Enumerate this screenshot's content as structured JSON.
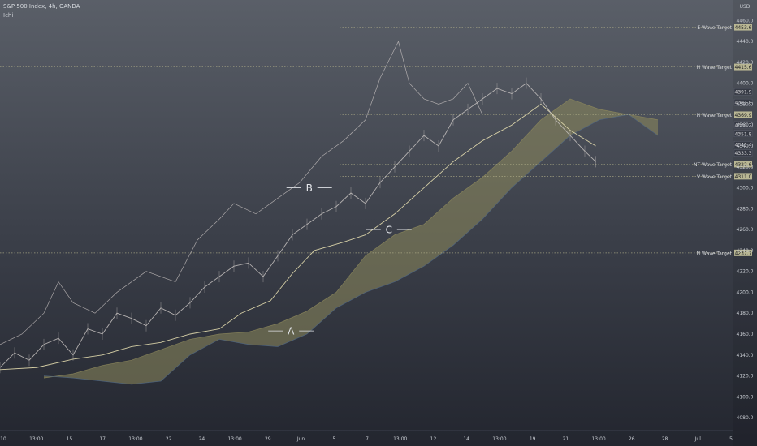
{
  "header": {
    "title": "S&P 500 Index, 4h, OANDA",
    "indicator": "Ichi"
  },
  "colors": {
    "price_line": "#c9c4c2",
    "kijun": "#e7dfb0",
    "tenkan": "#d9d2ce",
    "bull_cloud": "#8e8a5c",
    "bear_cloud": "#4d6787",
    "target_line": "#b6b48c",
    "axis_text": "#c8ccd2"
  },
  "chart_data": {
    "type": "line",
    "y_unit": "USD",
    "ylim": [
      4070,
      4475
    ],
    "y_ticks": [
      4080,
      4100,
      4120,
      4140,
      4160,
      4180,
      4200,
      4220,
      4240,
      4260,
      4280,
      4300,
      4320,
      4340,
      4360,
      4380,
      4400,
      4420,
      4440,
      4460
    ],
    "x_ticks": [
      "10",
      "13:00",
      "15",
      "17",
      "13:00",
      "22",
      "24",
      "13:00",
      "29",
      "Jun",
      "5",
      "7",
      "13:00",
      "12",
      "14",
      "13:00",
      "19",
      "21",
      "13:00",
      "26",
      "28",
      "Jul",
      "5"
    ],
    "grid": false,
    "wave_targets": [
      {
        "name": "E Wave Target",
        "value": 4453.6,
        "label": "4453.6"
      },
      {
        "name": "N Wave Target",
        "value": 4415.6,
        "label": "4415.6"
      },
      {
        "name": "N Wave Target",
        "value": 4369.9,
        "label": "4369.9"
      },
      {
        "name": "NT Wave Target",
        "value": 4322.6,
        "label": "4322.6"
      },
      {
        "name": "V Wave Target",
        "value": 4311.0,
        "label": "4311.0"
      },
      {
        "name": "N Wave Target",
        "value": 4237.7,
        "label": "4237.7"
      }
    ],
    "price_tags": [
      "4391.9",
      "4381.8",
      "4360.2",
      "4351.8",
      "4341.4",
      "4333.3"
    ],
    "wave_points": [
      {
        "label": "A",
        "x": 0.398,
        "y": 4163
      },
      {
        "label": "B",
        "x": 0.423,
        "y": 4300
      },
      {
        "label": "C",
        "x": 0.532,
        "y": 4260
      }
    ],
    "series": [
      {
        "name": "",
        "role": "price",
        "x": [
          0.0,
          0.02,
          0.04,
          0.06,
          0.08,
          0.1,
          0.12,
          0.14,
          0.16,
          0.18,
          0.2,
          0.22,
          0.24,
          0.26,
          0.28,
          0.3,
          0.32,
          0.34,
          0.36,
          0.38,
          0.4,
          0.42,
          0.44,
          0.46,
          0.48,
          0.5,
          0.52,
          0.54,
          0.56,
          0.58,
          0.6,
          0.62,
          0.64,
          0.66,
          0.68,
          0.7,
          0.72,
          0.74,
          0.76,
          0.78,
          0.8,
          0.815
        ],
        "y": [
          4128,
          4142,
          4135,
          4150,
          4156,
          4140,
          4165,
          4160,
          4180,
          4175,
          4168,
          4185,
          4178,
          4190,
          4205,
          4215,
          4225,
          4228,
          4215,
          4235,
          4255,
          4265,
          4275,
          4282,
          4295,
          4285,
          4305,
          4320,
          4335,
          4350,
          4340,
          4365,
          4375,
          4385,
          4395,
          4390,
          4400,
          4385,
          4365,
          4350,
          4335,
          4325
        ]
      },
      {
        "name": "",
        "role": "kijun",
        "x": [
          0.0,
          0.05,
          0.1,
          0.14,
          0.18,
          0.22,
          0.26,
          0.3,
          0.33,
          0.37,
          0.4,
          0.43,
          0.47,
          0.5,
          0.54,
          0.58,
          0.62,
          0.66,
          0.7,
          0.74,
          0.78,
          0.815
        ],
        "y": [
          4126,
          4128,
          4136,
          4140,
          4148,
          4152,
          4160,
          4165,
          4180,
          4192,
          4218,
          4240,
          4248,
          4255,
          4275,
          4300,
          4325,
          4345,
          4360,
          4380,
          4355,
          4340
        ]
      },
      {
        "name": "",
        "role": "lagging",
        "x": [
          0.0,
          0.03,
          0.06,
          0.08,
          0.1,
          0.13,
          0.16,
          0.2,
          0.24,
          0.27,
          0.3,
          0.32,
          0.35,
          0.38,
          0.41,
          0.44,
          0.47,
          0.5,
          0.52,
          0.545,
          0.56,
          0.58,
          0.6,
          0.62,
          0.64,
          0.66
        ],
        "y": [
          4150,
          4160,
          4180,
          4210,
          4190,
          4180,
          4200,
          4220,
          4210,
          4250,
          4270,
          4285,
          4275,
          4290,
          4305,
          4330,
          4345,
          4365,
          4405,
          4440,
          4400,
          4385,
          4380,
          4385,
          4400,
          4370
        ]
      },
      {
        "name": "",
        "role": "senkou_a",
        "x": [
          0.06,
          0.1,
          0.14,
          0.18,
          0.22,
          0.26,
          0.3,
          0.34,
          0.38,
          0.42,
          0.46,
          0.5,
          0.54,
          0.58,
          0.62,
          0.66,
          0.7,
          0.74,
          0.78,
          0.82,
          0.86,
          0.9
        ],
        "y": [
          4118,
          4122,
          4130,
          4135,
          4145,
          4155,
          4160,
          4162,
          4170,
          4182,
          4200,
          4235,
          4255,
          4265,
          4290,
          4310,
          4335,
          4365,
          4385,
          4375,
          4370,
          4365
        ]
      },
      {
        "name": "",
        "role": "senkou_b",
        "x": [
          0.06,
          0.1,
          0.14,
          0.18,
          0.22,
          0.26,
          0.3,
          0.34,
          0.38,
          0.42,
          0.46,
          0.5,
          0.54,
          0.58,
          0.62,
          0.66,
          0.7,
          0.74,
          0.78,
          0.82,
          0.86,
          0.9
        ],
        "y": [
          4120,
          4118,
          4115,
          4112,
          4115,
          4140,
          4155,
          4150,
          4148,
          4160,
          4185,
          4200,
          4210,
          4225,
          4245,
          4270,
          4300,
          4325,
          4350,
          4365,
          4370,
          4350
        ]
      }
    ]
  }
}
